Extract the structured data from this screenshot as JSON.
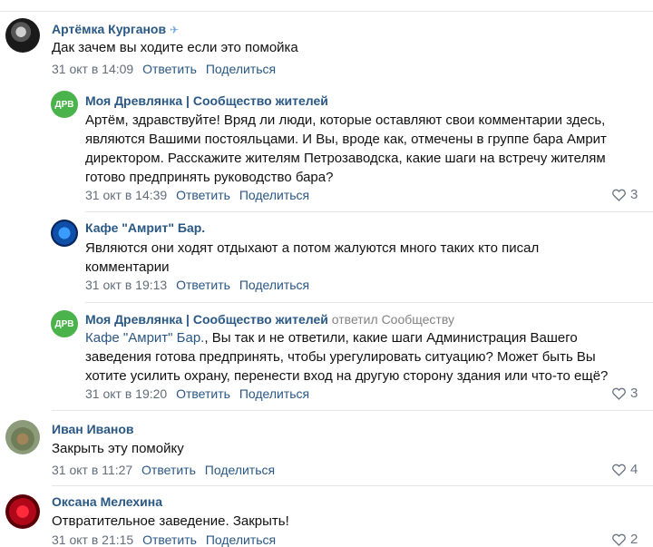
{
  "comments": [
    {
      "author": "Артёмка Курганов",
      "text": "Дак зачем вы ходите если это помойка",
      "date": "31 окт в 14:09",
      "reply": "Ответить",
      "share": "Поделиться"
    },
    {
      "author": "Моя Древлянка | Сообщество жителей",
      "avatar_label": "ДРВ",
      "text": "Артём, здравствуйте! Вряд ли люди, которые оставляют свои комментарии здесь, являются Вашими постояльцами. И Вы, вроде как, отмечены в группе бара Амрит директором. Расскажите жителям Петрозаводска, какие шаги на встречу жителям готово предпринять руководство бара?",
      "date": "31 окт в 14:39",
      "reply": "Ответить",
      "share": "Поделиться",
      "likes": "3"
    },
    {
      "author": "Кафе \"Амрит\" Бар.",
      "text": "Являются они ходят отдыхают а потом жалуются много таких кто писал комментарии",
      "date": "31 окт в 19:13",
      "reply": "Ответить",
      "share": "Поделиться"
    },
    {
      "author": "Моя Древлянка | Сообщество жителей",
      "avatar_label": "ДРВ",
      "replied_to": "ответил Сообществу",
      "mention": "Кафе \"Амрит\" Бар.",
      "text": ", Вы так и не ответили, какие шаги Администрация Вашего заведения готова предпринять, чтобы урегулировать ситуацию? Может быть Вы хотите усилить охрану, перенести вход на другую сторону здания или что-то ещё?",
      "date": "31 окт в 19:20",
      "reply": "Ответить",
      "share": "Поделиться",
      "likes": "3"
    },
    {
      "author": "Иван Иванов",
      "text": "Закрыть эту помойку",
      "date": "31 окт в 11:27",
      "reply": "Ответить",
      "share": "Поделиться",
      "likes": "4"
    },
    {
      "author": "Оксана Мелехина",
      "text": "Отвратительное заведение. Закрыть!",
      "date": "31 окт в 21:15",
      "reply": "Ответить",
      "share": "Поделиться",
      "likes": "2"
    }
  ],
  "colors": {
    "link": "#2a5885",
    "meta": "#626d7a",
    "divider": "#e3e6ea",
    "group_avatar": "#4bb34b"
  },
  "icons": [
    "heart-outline-icon",
    "avatar-photo"
  ]
}
